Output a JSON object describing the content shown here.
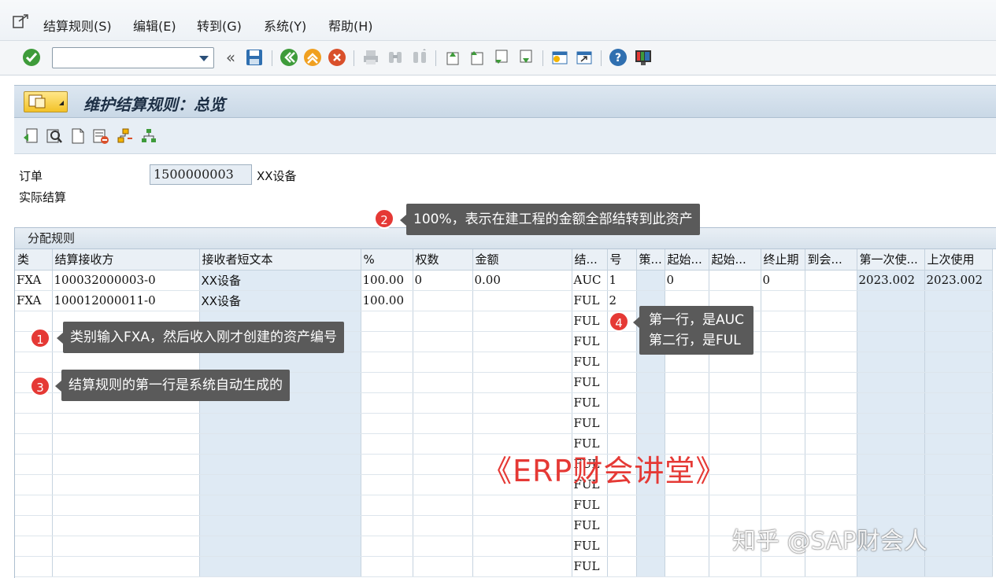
{
  "menu": {
    "items": [
      "结算规则(S)",
      "编辑(E)",
      "转到(G)",
      "系统(Y)",
      "帮助(H)"
    ]
  },
  "toolbar": {
    "command_value": "",
    "back_symbol": "«"
  },
  "title": "维护结算规则：总览",
  "form": {
    "order_label": "订单",
    "order_value": "1500000003",
    "order_desc": "XX设备",
    "actual_label": "实际结算"
  },
  "table": {
    "title": "分配规则",
    "headers": [
      "类",
      "结算接收方",
      "接收者短文本",
      "%",
      "权数",
      "金额",
      "结...",
      "号",
      "策...",
      "起始...",
      "起始...",
      "终止期",
      "到会...",
      "第一次使...",
      "上次使用"
    ],
    "rows": [
      [
        "FXA",
        "100032000003-0",
        "XX设备",
        "100.00",
        "0",
        "0.00",
        "AUC",
        "1",
        "",
        "0",
        "",
        "0",
        "",
        "2023.002",
        "2023.002"
      ],
      [
        "FXA",
        "100012000011-0",
        "XX设备",
        "100.00",
        "",
        "",
        "FUL",
        "2",
        "",
        "",
        "",
        "",
        "",
        "",
        ""
      ],
      [
        "",
        "",
        "",
        "",
        "",
        "",
        "FUL",
        "",
        "",
        "",
        "",
        "",
        "",
        "",
        ""
      ],
      [
        "",
        "",
        "",
        "",
        "",
        "",
        "FUL",
        "",
        "",
        "",
        "",
        "",
        "",
        "",
        ""
      ],
      [
        "",
        "",
        "",
        "",
        "",
        "",
        "FUL",
        "",
        "",
        "",
        "",
        "",
        "",
        "",
        ""
      ],
      [
        "",
        "",
        "",
        "",
        "",
        "",
        "FUL",
        "",
        "",
        "",
        "",
        "",
        "",
        "",
        ""
      ],
      [
        "",
        "",
        "",
        "",
        "",
        "",
        "FUL",
        "",
        "",
        "",
        "",
        "",
        "",
        "",
        ""
      ],
      [
        "",
        "",
        "",
        "",
        "",
        "",
        "FUL",
        "",
        "",
        "",
        "",
        "",
        "",
        "",
        ""
      ],
      [
        "",
        "",
        "",
        "",
        "",
        "",
        "FUL",
        "",
        "",
        "",
        "",
        "",
        "",
        "",
        ""
      ],
      [
        "",
        "",
        "",
        "",
        "",
        "",
        "FUL",
        "",
        "",
        "",
        "",
        "",
        "",
        "",
        ""
      ],
      [
        "",
        "",
        "",
        "",
        "",
        "",
        "FUL",
        "",
        "",
        "",
        "",
        "",
        "",
        "",
        ""
      ],
      [
        "",
        "",
        "",
        "",
        "",
        "",
        "FUL",
        "",
        "",
        "",
        "",
        "",
        "",
        "",
        ""
      ],
      [
        "",
        "",
        "",
        "",
        "",
        "",
        "FUL",
        "",
        "",
        "",
        "",
        "",
        "",
        "",
        ""
      ],
      [
        "",
        "",
        "",
        "",
        "",
        "",
        "FUL",
        "",
        "",
        "",
        "",
        "",
        "",
        "",
        ""
      ],
      [
        "",
        "",
        "",
        "",
        "",
        "",
        "FUL",
        "",
        "",
        "",
        "",
        "",
        "",
        "",
        ""
      ]
    ]
  },
  "annotations": [
    {
      "num": "1",
      "text": "类别输入FXA，然后收入刚才创建的资产编号"
    },
    {
      "num": "2",
      "text": "100%，表示在建工程的金额全部结转到此资产"
    },
    {
      "num": "3",
      "text": "结算规则的第一行是系统自动生成的"
    },
    {
      "num": "4",
      "line1": "第一行，是AUC",
      "line2": "第二行，是FUL"
    }
  ],
  "watermarks": {
    "brand": "《ERP财会讲堂》",
    "author": "知乎 @SAP财会人"
  },
  "colors": {
    "badge_red": "#e53935",
    "callout_bg": "#5a5a5a",
    "title_bar": "#c9d8e6"
  }
}
